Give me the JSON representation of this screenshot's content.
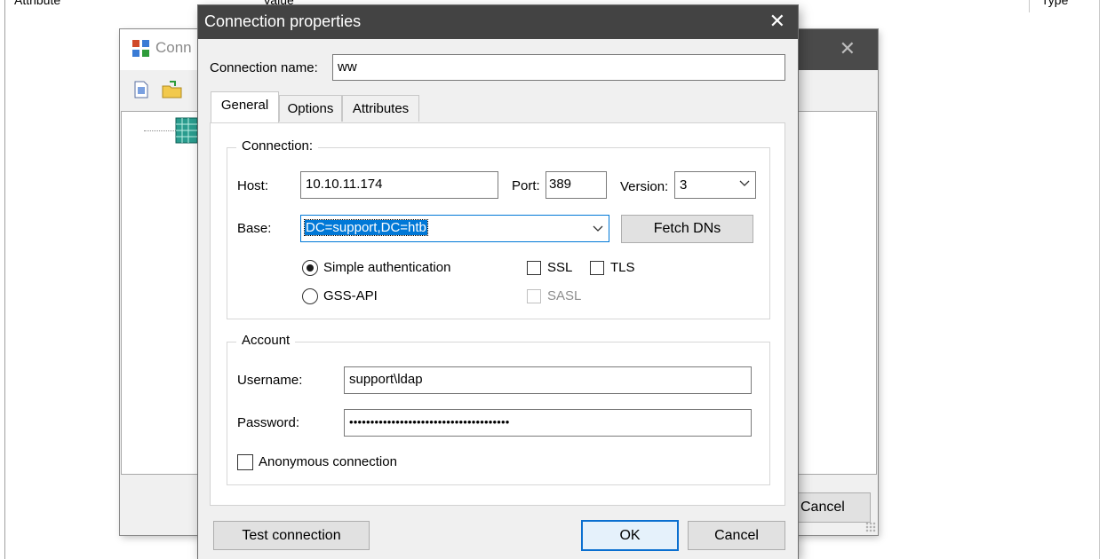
{
  "background": {
    "col_attribute": "Attribute",
    "col_value": "Value",
    "col_type": "Type"
  },
  "back_dialog": {
    "title_fragment": "Conn",
    "close_glyph": "✕",
    "cancel_label": "Cancel"
  },
  "dialog": {
    "title": "Connection properties",
    "close_glyph": "✕",
    "connection_name_label": "Connection name:",
    "connection_name_value": "ww",
    "tabs": [
      {
        "label": "General",
        "active": true
      },
      {
        "label": "Options",
        "active": false
      },
      {
        "label": "Attributes",
        "active": false
      }
    ],
    "connection_group": {
      "title": "Connection:",
      "host_label": "Host:",
      "host_value": "10.10.11.174",
      "port_label": "Port:",
      "port_value": "389",
      "version_label": "Version:",
      "version_value": "3",
      "base_label": "Base:",
      "base_value": "DC=support,DC=htb",
      "fetch_dns_label": "Fetch DNs",
      "simple_auth_label": "Simple authentication",
      "simple_auth_selected": true,
      "gss_api_label": "GSS-API",
      "ssl_label": "SSL",
      "tls_label": "TLS",
      "sasl_label": "SASL"
    },
    "account_group": {
      "title": "Account",
      "username_label": "Username:",
      "username_value": "support\\ldap",
      "password_label": "Password:",
      "password_value": "••••••••••••••••••••••••••••••••••••••",
      "anonymous_label": "Anonymous connection"
    },
    "buttons": {
      "test_connection": "Test connection",
      "ok": "OK",
      "cancel": "Cancel"
    }
  },
  "colors": {
    "title_bar": "#434343",
    "selection": "#0078d7",
    "default_button_border": "#0a6fd0"
  }
}
